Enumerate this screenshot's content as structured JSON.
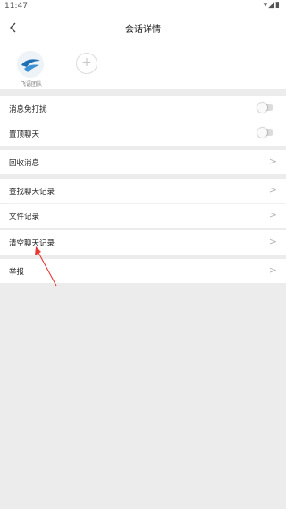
{
  "status_bar": {
    "time": "11:47",
    "icons": "▾◢▮"
  },
  "header": {
    "back_icon": "chevron-left-icon",
    "title": "会话详情"
  },
  "members": [
    {
      "name": "飞语团队",
      "avatar_icon": "swoosh-logo-icon"
    }
  ],
  "add_member": {
    "icon": "plus-icon",
    "glyph": "+"
  },
  "settings": {
    "mute": {
      "label": "消息免打扰",
      "enabled": false
    },
    "pin": {
      "label": "置顶聊天",
      "enabled": false
    },
    "recall": {
      "label": "回收消息"
    },
    "search_history": {
      "label": "查找聊天记录"
    },
    "file_records": {
      "label": "文件记录"
    },
    "clear_history": {
      "label": "清空聊天记录"
    },
    "report": {
      "label": "举报"
    }
  },
  "chevron_glyph": ">",
  "colors": {
    "page_bg": "#ececec",
    "arrow": "#e53935",
    "logo_blue": "#1f6fb2"
  }
}
